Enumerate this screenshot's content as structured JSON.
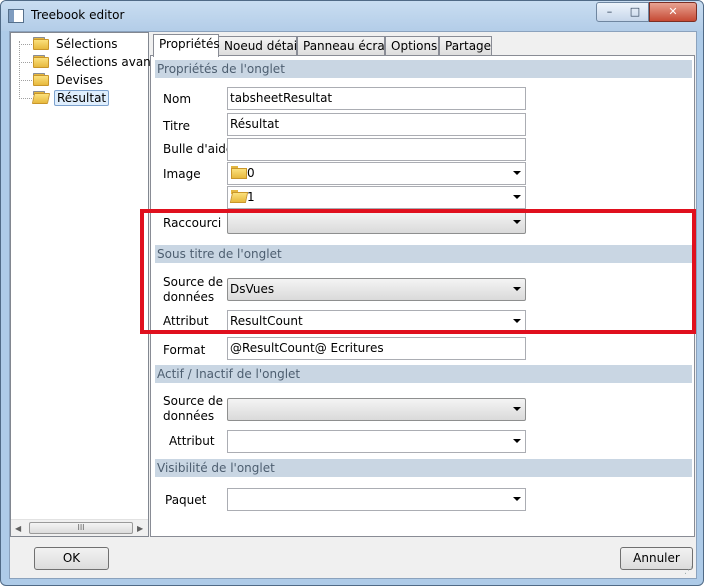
{
  "window": {
    "title": "Treebook editor"
  },
  "tree": {
    "items": [
      {
        "label": "Sélections"
      },
      {
        "label": "Sélections avancé"
      },
      {
        "label": "Devises"
      },
      {
        "label": "Résultat"
      }
    ],
    "scroll_thumb": "III"
  },
  "tabs": [
    {
      "label": "Propriétés"
    },
    {
      "label": "Noeud détail"
    },
    {
      "label": "Panneau écran"
    },
    {
      "label": "Options"
    },
    {
      "label": "Partage"
    }
  ],
  "sections": {
    "proprietes": {
      "title": "Propriétés de l'onglet",
      "nom_label": "Nom",
      "nom_value": "tabsheetResultat",
      "titre_label": "Titre",
      "titre_value": "Résultat",
      "bulle_label": "Bulle d'aide",
      "bulle_value": "",
      "image_label": "Image",
      "image1_value": "0",
      "image2_value": "1",
      "raccourci_label": "Raccourci",
      "raccourci_value": ""
    },
    "sous_titre": {
      "title": "Sous titre de l'onglet",
      "source_label_1": "Source de",
      "source_label_2": "données",
      "source_value": "DsVues",
      "attribut_label": "Attribut",
      "attribut_value": "ResultCount",
      "format_label": "Format",
      "format_value": "@ResultCount@ Ecritures"
    },
    "actif": {
      "title": "Actif / Inactif de l'onglet",
      "source_label_1": "Source de",
      "source_label_2": "données",
      "source_value": "",
      "attribut_label": "Attribut",
      "attribut_value": ""
    },
    "visibilite": {
      "title": "Visibilité de l'onglet",
      "paquet_label": "Paquet",
      "paquet_value": ""
    }
  },
  "buttons": {
    "ok": "OK",
    "cancel": "Annuler"
  },
  "colors": {
    "highlight": "#e0101e",
    "section_header": "#c9d6e3"
  }
}
